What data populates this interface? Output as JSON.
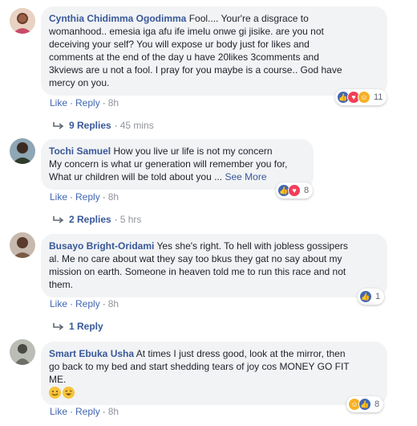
{
  "comments": [
    {
      "author": "Cynthia Chidimma Ogodimma",
      "text": "Fool.... Your're a disgrace to\nwomanhood.. emesia iga afu ife imelu onwe gi jisike. are you not\ndeceiving your self? You will expose ur body just for likes and\ncomments at the end of the day u have 20likes 3comments and\n3kviews are u not a fool. I pray for you maybe is a course.. God have\nmercy on you.",
      "like": "Like",
      "reply": "Reply",
      "time": "8h",
      "reactions_count": "11",
      "replies_label": "9 Replies",
      "replies_time": "45 mins"
    },
    {
      "author": "Tochi Samuel",
      "text_first": "How you live ur life is not my concern",
      "text": "My concern is what ur generation will remember you for,\nWhat ur children will be told about you ...",
      "see_more": "See More",
      "like": "Like",
      "reply": "Reply",
      "time": "8h",
      "reactions_count": "8",
      "replies_label": "2 Replies",
      "replies_time": "5 hrs"
    },
    {
      "author": "Busayo Bright-Oridami",
      "text_first": "Yes she's right. To hell with jobless gossipers",
      "text": "al. Me no care about wat they say too bkus they gat no say about my\nmission on earth. Someone in heaven told me to run this race and not\nthem.",
      "like": "Like",
      "reply": "Reply",
      "time": "8h",
      "reactions_count": "1",
      "replies_label": "1 Reply"
    },
    {
      "author": "Smart Ebuka Usha",
      "text_first": "At times I just dress good, look at the mirror, then",
      "text": "go back to my bed and start shedding tears of joy cos MONEY GO FIT\nME.",
      "like": "Like",
      "reply": "Reply",
      "time": "8h",
      "reactions_count": "8"
    }
  ],
  "separator": "·",
  "icons": {
    "like": "thumbs-up-icon",
    "love": "heart-icon",
    "haha": "laughing-face-icon"
  },
  "colors": {
    "link": "#385898",
    "action": "#4267b2",
    "bubble": "#f2f3f5",
    "like_reaction": "#4267b2",
    "love_reaction": "#f33e58",
    "haha_reaction": "#f7b125"
  }
}
